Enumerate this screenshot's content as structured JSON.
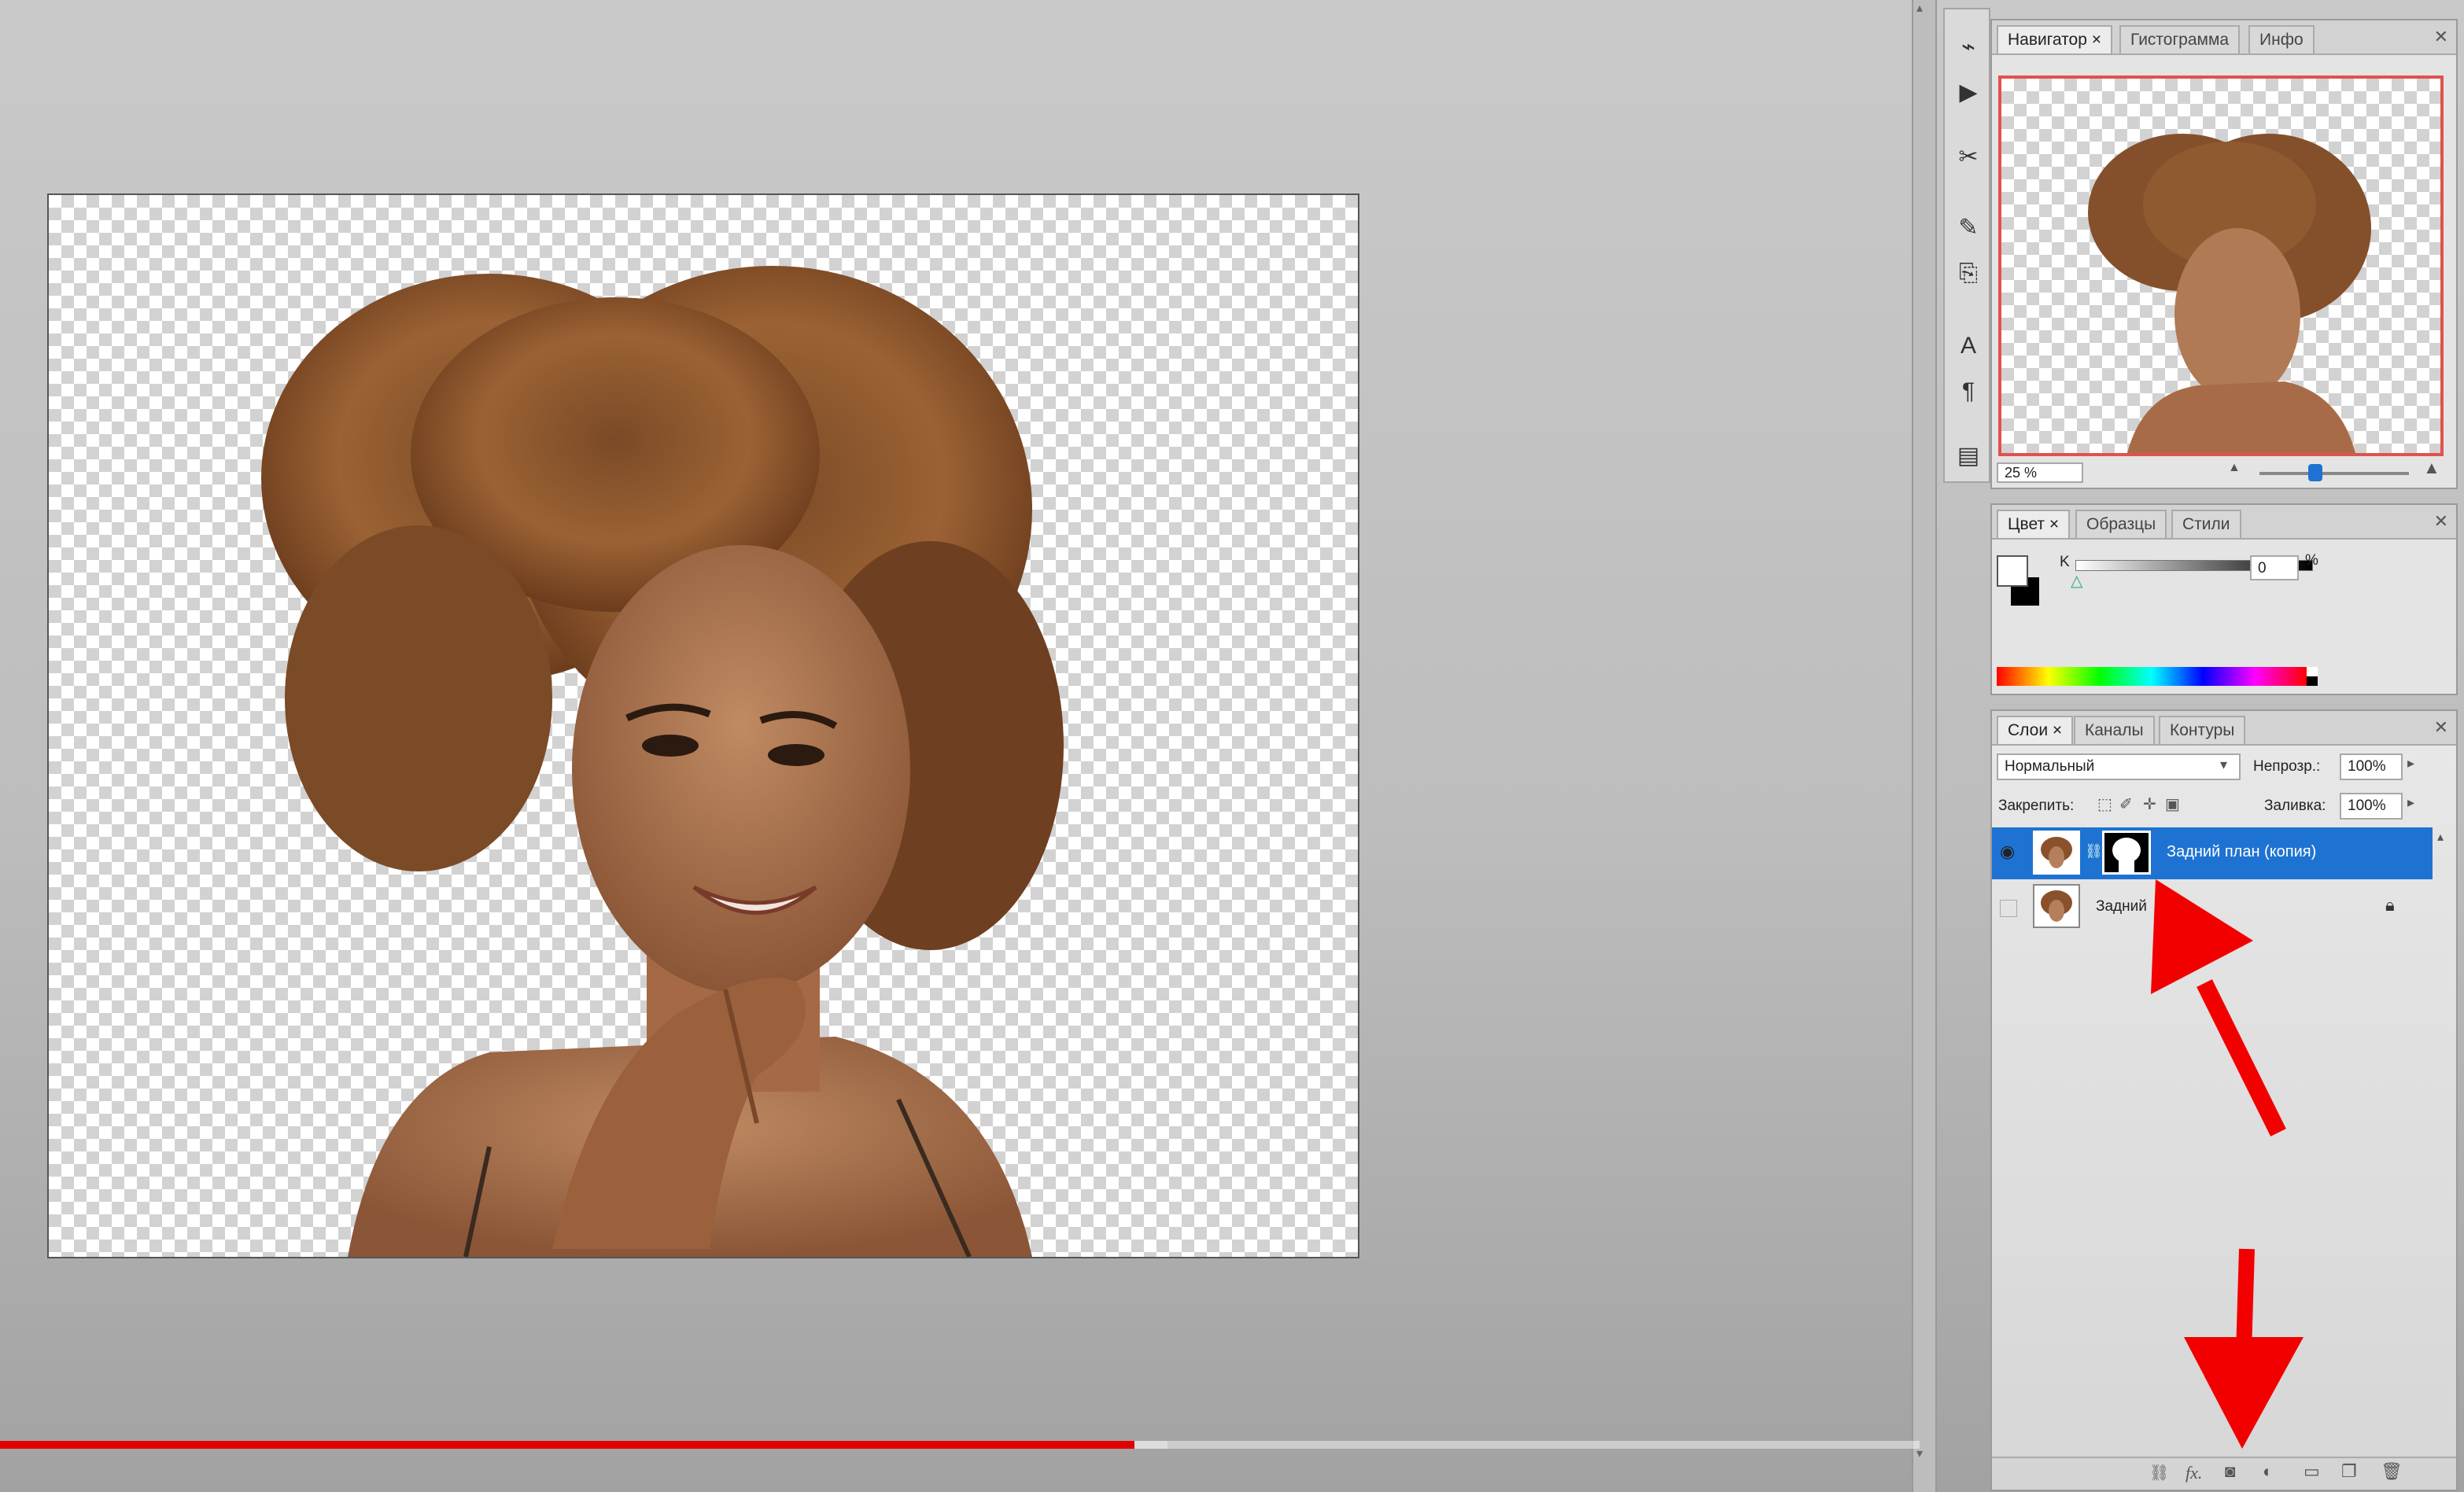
{
  "navigator": {
    "tabs": [
      {
        "label": "Навигатор ×"
      },
      {
        "label": "Гистограмма"
      },
      {
        "label": "Инфо"
      }
    ],
    "zoom": "25 %"
  },
  "color_panel": {
    "tabs": [
      {
        "label": "Цвет ×"
      },
      {
        "label": "Образцы"
      },
      {
        "label": "Стили"
      }
    ],
    "channel_label": "K",
    "value": "0",
    "unit": "%"
  },
  "layers_panel": {
    "tabs": [
      {
        "label": "Слои ×"
      },
      {
        "label": "Каналы"
      },
      {
        "label": "Контуры"
      }
    ],
    "blend_mode": "Нормальный",
    "opacity_label": "Непрозр.:",
    "opacity": "100%",
    "lock_label": "Закрепить:",
    "fill_label": "Заливка:",
    "fill": "100%",
    "layers": [
      {
        "name": "Задний план (копия)",
        "selected": true,
        "has_mask": true
      },
      {
        "name": "Задний",
        "selected": false,
        "locked": true
      }
    ],
    "footer_icons": [
      "link-layers-icon",
      "fx-icon",
      "add-mask-icon",
      "adjustment-layer-icon",
      "group-icon",
      "new-layer-icon",
      "trash-icon"
    ],
    "fx_label": "fx."
  },
  "video": {
    "progress": 0.46,
    "accent": "#e00000"
  },
  "colors": {
    "arrow": "#f20000",
    "selection": "#1e73d2"
  }
}
